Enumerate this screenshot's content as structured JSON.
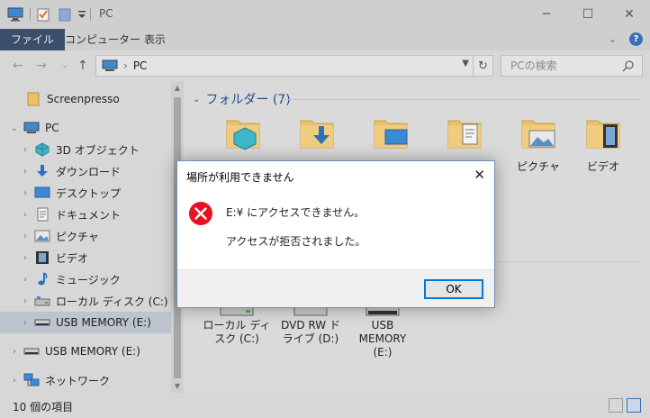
{
  "titlebar": {
    "title": "PC",
    "minimize": "─",
    "maximize": "☐",
    "close": "✕"
  },
  "ribbon": {
    "tabs": [
      "ファイル",
      "コンピューター",
      "表示"
    ],
    "collapse": "⌄",
    "help": "?"
  },
  "address": {
    "back": "←",
    "forward": "→",
    "recent": "⌄",
    "up": "↑",
    "path": "PC",
    "path_sep": "›",
    "search_placeholder": "PCの検索"
  },
  "navpane": {
    "items": [
      {
        "label": "Screenpresso",
        "icon": "folder-icon",
        "chevron": ""
      },
      {
        "label": "PC",
        "icon": "pc-icon",
        "chevron": "⌄"
      },
      {
        "label": "3D オブジェクト",
        "icon": "3d-objects-icon",
        "chevron": "›"
      },
      {
        "label": "ダウンロード",
        "icon": "download-icon",
        "chevron": "›"
      },
      {
        "label": "デスクトップ",
        "icon": "desktop-icon",
        "chevron": "›"
      },
      {
        "label": "ドキュメント",
        "icon": "documents-icon",
        "chevron": "›"
      },
      {
        "label": "ピクチャ",
        "icon": "pictures-icon",
        "chevron": "›"
      },
      {
        "label": "ビデオ",
        "icon": "videos-icon",
        "chevron": "›"
      },
      {
        "label": "ミュージック",
        "icon": "music-icon",
        "chevron": "›"
      },
      {
        "label": "ローカル ディスク (C:)",
        "icon": "local-disk-icon",
        "chevron": "›"
      },
      {
        "label": "USB MEMORY (E:)",
        "icon": "usb-drive-icon",
        "chevron": "›"
      },
      {
        "label": "USB MEMORY (E:)",
        "icon": "usb-drive-icon",
        "chevron": "›"
      },
      {
        "label": "ネットワーク",
        "icon": "network-icon",
        "chevron": "›"
      }
    ]
  },
  "content": {
    "group_title": "フォルダー (7)",
    "folders": [
      {
        "label": "",
        "icon": "3d-objects-folder-icon"
      },
      {
        "label": "",
        "icon": "downloads-folder-icon"
      },
      {
        "label": "",
        "icon": "desktop-folder-icon"
      },
      {
        "label": "",
        "icon": "documents-folder-icon"
      },
      {
        "label": "ピクチャ",
        "icon": "pictures-folder-icon"
      },
      {
        "label": "ビデオ",
        "icon": "videos-folder-icon"
      }
    ],
    "drives": [
      {
        "line1": "ローカル ディ",
        "line2": "スク (C:)",
        "line3": "",
        "icon": "local-disk-icon"
      },
      {
        "line1": "DVD RW ド",
        "line2": "ライブ (D:)",
        "line3": "",
        "icon": "dvd-drive-icon"
      },
      {
        "line1": "USB",
        "line2": "MEMORY",
        "line3": "(E:)",
        "icon": "usb-drive-icon"
      }
    ]
  },
  "status": {
    "count": "10 個の項目"
  },
  "dialog": {
    "title": "場所が利用できません",
    "close": "✕",
    "message1": "E:¥ にアクセスできません。",
    "message2": "アクセスが拒否されました。",
    "ok_label": "OK"
  },
  "colors": {
    "accent": "#0078d7",
    "error": "#e81123",
    "folder": "#e8c06a",
    "title_blue": "#1e4e8c"
  }
}
